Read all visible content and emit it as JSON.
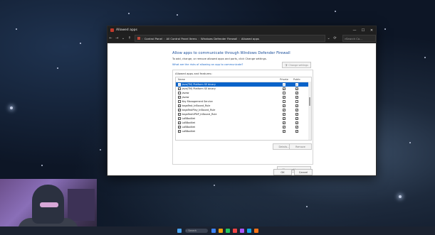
{
  "window": {
    "title": "Allowed apps",
    "minimize": "—",
    "maximize": "☐",
    "close": "✕"
  },
  "address": {
    "breadcrumbs": [
      "Control Panel",
      "All Control Panel Items",
      "Windows Defender Firewall",
      "Allowed apps"
    ],
    "search_placeholder": "Search Co..."
  },
  "content": {
    "title": "Allow apps to communicate through Windows Defender Firewall",
    "subtitle": "To add, change, or remove allowed apps and ports, click Change settings.",
    "risk_link": "What are the risks of allowing an app to communicate?",
    "change_settings": "Change settings",
    "group_label": "Allowed apps and features:",
    "columns": {
      "name": "Name",
      "private": "Private",
      "public": "Public"
    },
    "apps": [
      {
        "name": "Java(TM) Platform SE binary",
        "enabled": true,
        "private": true,
        "public": true,
        "selected": true
      },
      {
        "name": "Java(TM) Platform SE binary",
        "enabled": true,
        "private": true,
        "public": true,
        "selected": false
      },
      {
        "name": "javaw",
        "enabled": false,
        "private": false,
        "public": true,
        "selected": false
      },
      {
        "name": "javaw",
        "enabled": true,
        "private": true,
        "public": true,
        "selected": false
      },
      {
        "name": "Key Management Service",
        "enabled": false,
        "private": false,
        "public": false,
        "selected": false
      },
      {
        "name": "kagaFast_InBound_Rule",
        "enabled": true,
        "private": true,
        "public": true,
        "selected": false
      },
      {
        "name": "kagaFastPlay_InBound_Rule",
        "enabled": true,
        "private": true,
        "public": true,
        "selected": false
      },
      {
        "name": "kagaFastUPNP_InBound_Rule",
        "enabled": true,
        "private": true,
        "public": true,
        "selected": false
      },
      {
        "name": "LoBBoxNet",
        "enabled": true,
        "private": true,
        "public": true,
        "selected": false
      },
      {
        "name": "LoBBoxNet",
        "enabled": true,
        "private": true,
        "public": true,
        "selected": false
      },
      {
        "name": "LoBBoxNet",
        "enabled": true,
        "private": true,
        "public": true,
        "selected": false
      },
      {
        "name": "LoBBoxNet",
        "enabled": true,
        "private": true,
        "public": true,
        "selected": false
      }
    ],
    "details": "Details...",
    "remove": "Remove",
    "allow_another": "Allow another app...",
    "ok": "OK",
    "cancel": "Cancel"
  },
  "taskbar": {
    "search": "Search",
    "icon_colors": [
      "#3b82f6",
      "#f59e0b",
      "#22c55e",
      "#ef4444",
      "#a855f7",
      "#0ea5e9",
      "#f97316"
    ]
  }
}
